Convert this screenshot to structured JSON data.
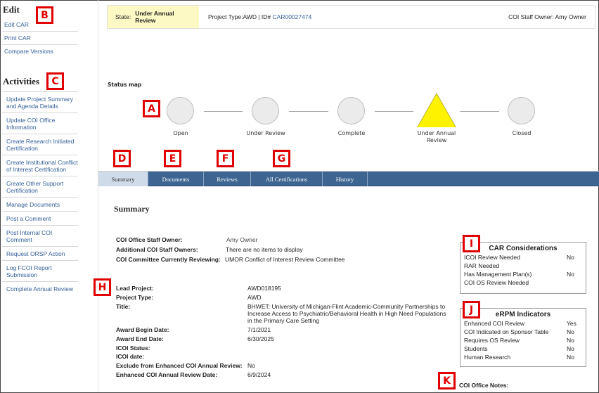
{
  "sidebar": {
    "edit_heading": "Edit",
    "edit_items": [
      {
        "label": "Edit CAR"
      },
      {
        "label": "Print CAR"
      },
      {
        "label": "Compare Versions"
      }
    ],
    "activities_heading": "Activities",
    "activity_items": [
      {
        "label": "Update Project Summary and Agenda Details"
      },
      {
        "label": "Update COI Office Information"
      },
      {
        "label": "Create Research Initiated Certification"
      },
      {
        "label": "Create Institutional Conflict of Interest Certification"
      },
      {
        "label": "Create Other Support Certification"
      },
      {
        "label": "Manage Documents"
      },
      {
        "label": "Post a Comment"
      },
      {
        "label": "Post Internal COI Comment"
      },
      {
        "label": "Request ORSP Action"
      },
      {
        "label": "Log FCOI Report Submission"
      },
      {
        "label": "Complete Annual Review"
      }
    ]
  },
  "statebar": {
    "state_label": "State:",
    "state_value": "Under Annual Review",
    "project_type_text": "Project Type:AWD | ID#",
    "car_id": "CAR00027474",
    "staff_owner_label": "COI Staff Owner:",
    "staff_owner_value": "Amy Owner",
    "state_color": "#fdf9c4"
  },
  "status_map": {
    "title": "Status map",
    "current": "Under Annual Review",
    "current_color": "#fff200",
    "nodes": [
      {
        "label": "Open",
        "shape": "circle"
      },
      {
        "label": "Under Review",
        "shape": "circle"
      },
      {
        "label": "Complete",
        "shape": "circle"
      },
      {
        "label": "Under Annual Review",
        "shape": "triangle"
      },
      {
        "label": "Closed",
        "shape": "circle"
      }
    ]
  },
  "tabs": [
    {
      "label": "Summary",
      "active": true
    },
    {
      "label": "Documents",
      "active": false
    },
    {
      "label": "Reviews",
      "active": false
    },
    {
      "label": "All Certifications",
      "active": false
    },
    {
      "label": "History",
      "active": false
    }
  ],
  "tab_bar_color": "#3e6591",
  "summary": {
    "title": "Summary",
    "office_fields": [
      {
        "key": "COI Office Staff Owner:",
        "value": "Amy Owner"
      },
      {
        "key": "Additional COI Staff Owners:",
        "value": "There are no items to display"
      },
      {
        "key": "COI Committee Currently Reviewing:",
        "value": "UMOR Conflict of Interest Review Committee"
      }
    ],
    "project_fields": [
      {
        "key": "Lead Project:",
        "value": "AWD018195"
      },
      {
        "key": "Project Type:",
        "value": "AWD"
      },
      {
        "key": "Title:",
        "value": "BHWET: University of Michigan-Flint Academic-Community Partnerships to Increase Access to Psychiatric/Behavioral Health in High Need Populations in the Primary Care Setting"
      },
      {
        "key": "Award Begin Date:",
        "value": "7/1/2021"
      },
      {
        "key": "Award End Date:",
        "value": "6/30/2025"
      },
      {
        "key": "ICOI Status:",
        "value": ""
      },
      {
        "key": "ICOI date:",
        "value": ""
      },
      {
        "key": "Exclude from Enhanced COI Annual Review:",
        "value": "No"
      },
      {
        "key": "Enhanced COI Annual Review Date:",
        "value": "6/9/2024"
      }
    ],
    "title_lines": [
      "BHWET: University of Michigan-Flint Academic-Community Partnerships to",
      "Increase Access to Psychiatric/Behavioral Health in High Need Populations",
      "in the Primary Care Setting"
    ]
  },
  "car_considerations": {
    "title": "CAR Considerations",
    "rows": [
      {
        "label": "ICOI Review Needed",
        "value": "No"
      },
      {
        "label": "RAR Needed",
        "value": ""
      },
      {
        "label": "Has Management Plan(s)",
        "value": "No"
      },
      {
        "label": "COI OS Review Needed",
        "value": ""
      }
    ]
  },
  "erpm_indicators": {
    "title": "eRPM Indicators",
    "rows": [
      {
        "label": "Enhanced COI Review",
        "value": "Yes"
      },
      {
        "label": "COI Indicated on Sponsor Table",
        "value": "No"
      },
      {
        "label": "Requires OS Review",
        "value": "No"
      },
      {
        "label": "Students",
        "value": "No"
      },
      {
        "label": "Human Research",
        "value": "No"
      }
    ]
  },
  "notes": {
    "label": "COI Office Notes:"
  },
  "markers": {
    "A": "A",
    "B": "B",
    "C": "C",
    "D": "D",
    "E": "E",
    "F": "F",
    "G": "G",
    "H": "H",
    "I": "I",
    "J": "J",
    "K": "K"
  },
  "marker_color": "#e00000"
}
